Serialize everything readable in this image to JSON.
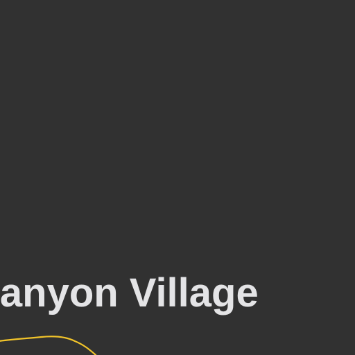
{
  "map": {
    "background_color": "#313131",
    "place_label": {
      "text": "Canyon Village",
      "color": "#e4e4e6"
    },
    "road": {
      "color": "#f2c42a"
    }
  }
}
